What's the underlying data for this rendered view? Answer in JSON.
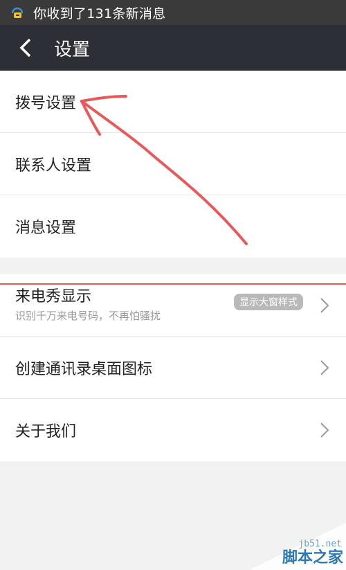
{
  "status_bar": {
    "notification": "你收到了131条新消息"
  },
  "header": {
    "title": "设置"
  },
  "group1": [
    {
      "label": "拨号设置"
    },
    {
      "label": "联系人设置"
    },
    {
      "label": "消息设置"
    }
  ],
  "group2": {
    "caller_show": {
      "label": "来电秀显示",
      "subtitle": "识别千万来电号码，不再怕骚扰",
      "badge": "显示大窗样式"
    },
    "shortcut": {
      "label": "创建通讯录桌面图标"
    },
    "about": {
      "label": "关于我们"
    }
  },
  "watermark": {
    "url": "jb51.net",
    "name": "脚本之家"
  },
  "colors": {
    "status_bar": "#3a3a3a",
    "title_bar": "#2c2f36",
    "annotation": "#e85a5a",
    "watermark": "#2d79b5"
  }
}
